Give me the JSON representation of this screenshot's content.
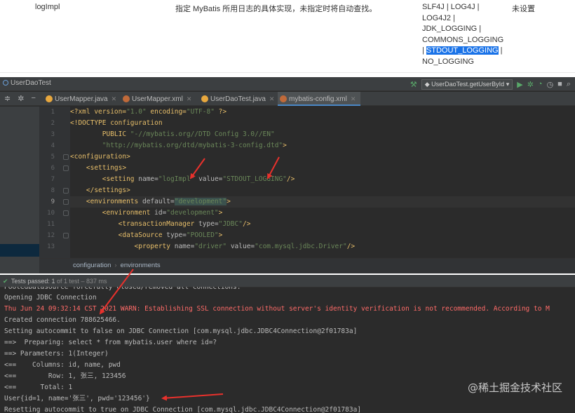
{
  "doc_table": {
    "setting_name": "logImpl",
    "description": "指定 MyBatis 所用日志的具体实现，未指定时将自动查找。",
    "valid_values_lines": [
      "SLF4J | LOG4J |",
      "LOG4J2 |",
      "JDK_LOGGING |",
      "COMMONS_LOGGING",
      "| ",
      "STDOUT_LOGGING",
      " |",
      "NO_LOGGING"
    ],
    "default_value": "未设置"
  },
  "ide": {
    "project_title": "UserDaoTest",
    "run_config": "UserDaoTest.getUserById",
    "tabs": [
      {
        "label": "UserMapper.java",
        "color": "#e8a83e"
      },
      {
        "label": "UserMapper.xml",
        "color": "#c06a3a"
      },
      {
        "label": "UserDaoTest.java",
        "color": "#e8a83e"
      },
      {
        "label": "mybatis-config.xml",
        "color": "#c06a3a"
      }
    ],
    "line_numbers": [
      "1",
      "2",
      "3",
      "4",
      "5",
      "6",
      "7",
      "8",
      "9",
      "10",
      "11",
      "12",
      "13"
    ],
    "breadcrumb": [
      "configuration",
      "environments"
    ]
  },
  "code": {
    "l1a": "<?xml version=",
    "l1b": "\"1.0\"",
    "l1c": " encoding=",
    "l1d": "\"UTF-8\"",
    "l1e": " ?>",
    "l2a": "<!DOCTYPE ",
    "l2b": "configuration",
    "l3a": "        PUBLIC ",
    "l3b": "\"-//mybatis.org//DTD Config 3.0//EN\"",
    "l4a": "        ",
    "l4b": "\"http://mybatis.org/dtd/mybatis-3-config.dtd\"",
    "l4c": ">",
    "l5": "<configuration>",
    "l6a": "    ",
    "l6b": "<settings>",
    "l7a": "        ",
    "l7b": "<setting ",
    "l7c": "name=",
    "l7d": "\"logImpl\"",
    "l7e": " value=",
    "l7f": "\"STDOUT_LOGGING\"",
    "l7g": "/>",
    "l8a": "    ",
    "l8b": "</settings>",
    "l9a": "    ",
    "l9b": "<environments ",
    "l9c": "default=",
    "l9d": "\"development\"",
    "l9e": ">",
    "l10a": "        ",
    "l10b": "<environment ",
    "l10c": "id=",
    "l10d": "\"development\"",
    "l10e": ">",
    "l11a": "            ",
    "l11b": "<transactionManager ",
    "l11c": "type=",
    "l11d": "\"JDBC\"",
    "l11e": "/>",
    "l12a": "            ",
    "l12b": "<dataSource ",
    "l12c": "type=",
    "l12d": "\"POOLED\"",
    "l12e": ">",
    "l13a": "                ",
    "l13b": "<property ",
    "l13c": "name=",
    "l13d": "\"driver\"",
    "l13e": " value=",
    "l13f": "\"com.mysql.jdbc.Driver\"",
    "l13g": "/>"
  },
  "console": {
    "status_label": "Tests passed:",
    "status_count": "1",
    "status_rest": "of 1 test – 837 ms",
    "cut_line": "Pooledbatasource forcefully closed/removed all connections.",
    "lines": [
      {
        "text": "Opening JDBC Connection",
        "kind": "normal"
      },
      {
        "text": "Thu Jun 24 09:32:14 CST 2021 WARN: Establishing SSL connection without server's identity verification is not recommended. According to M",
        "kind": "warn"
      },
      {
        "text": "Created connection 788625466.",
        "kind": "normal"
      },
      {
        "text": "Setting autocommit to false on JDBC Connection [com.mysql.jdbc.JDBC4Connection@2f01783a]",
        "kind": "normal"
      },
      {
        "text": "==>  Preparing: select * from mybatis.user where id=?",
        "kind": "normal"
      },
      {
        "text": "==> Parameters: 1(Integer)",
        "kind": "normal"
      },
      {
        "text": "<==    Columns: id, name, pwd",
        "kind": "normal"
      },
      {
        "text": "<==        Row: 1, 张三, 123456",
        "kind": "normal"
      },
      {
        "text": "<==      Total: 1",
        "kind": "normal"
      },
      {
        "text": "User{id=1, name='张三', pwd='123456'}",
        "kind": "normal"
      },
      {
        "text": "Resetting autocommit to true on JDBC Connection [com.mysql.jdbc.JDBC4Connection@2f01783a]",
        "kind": "normal"
      }
    ]
  },
  "watermark": "@稀土掘金技术社区",
  "colors": {
    "annotation_arrow": "#e8312c",
    "selection": "#1a73e8"
  }
}
